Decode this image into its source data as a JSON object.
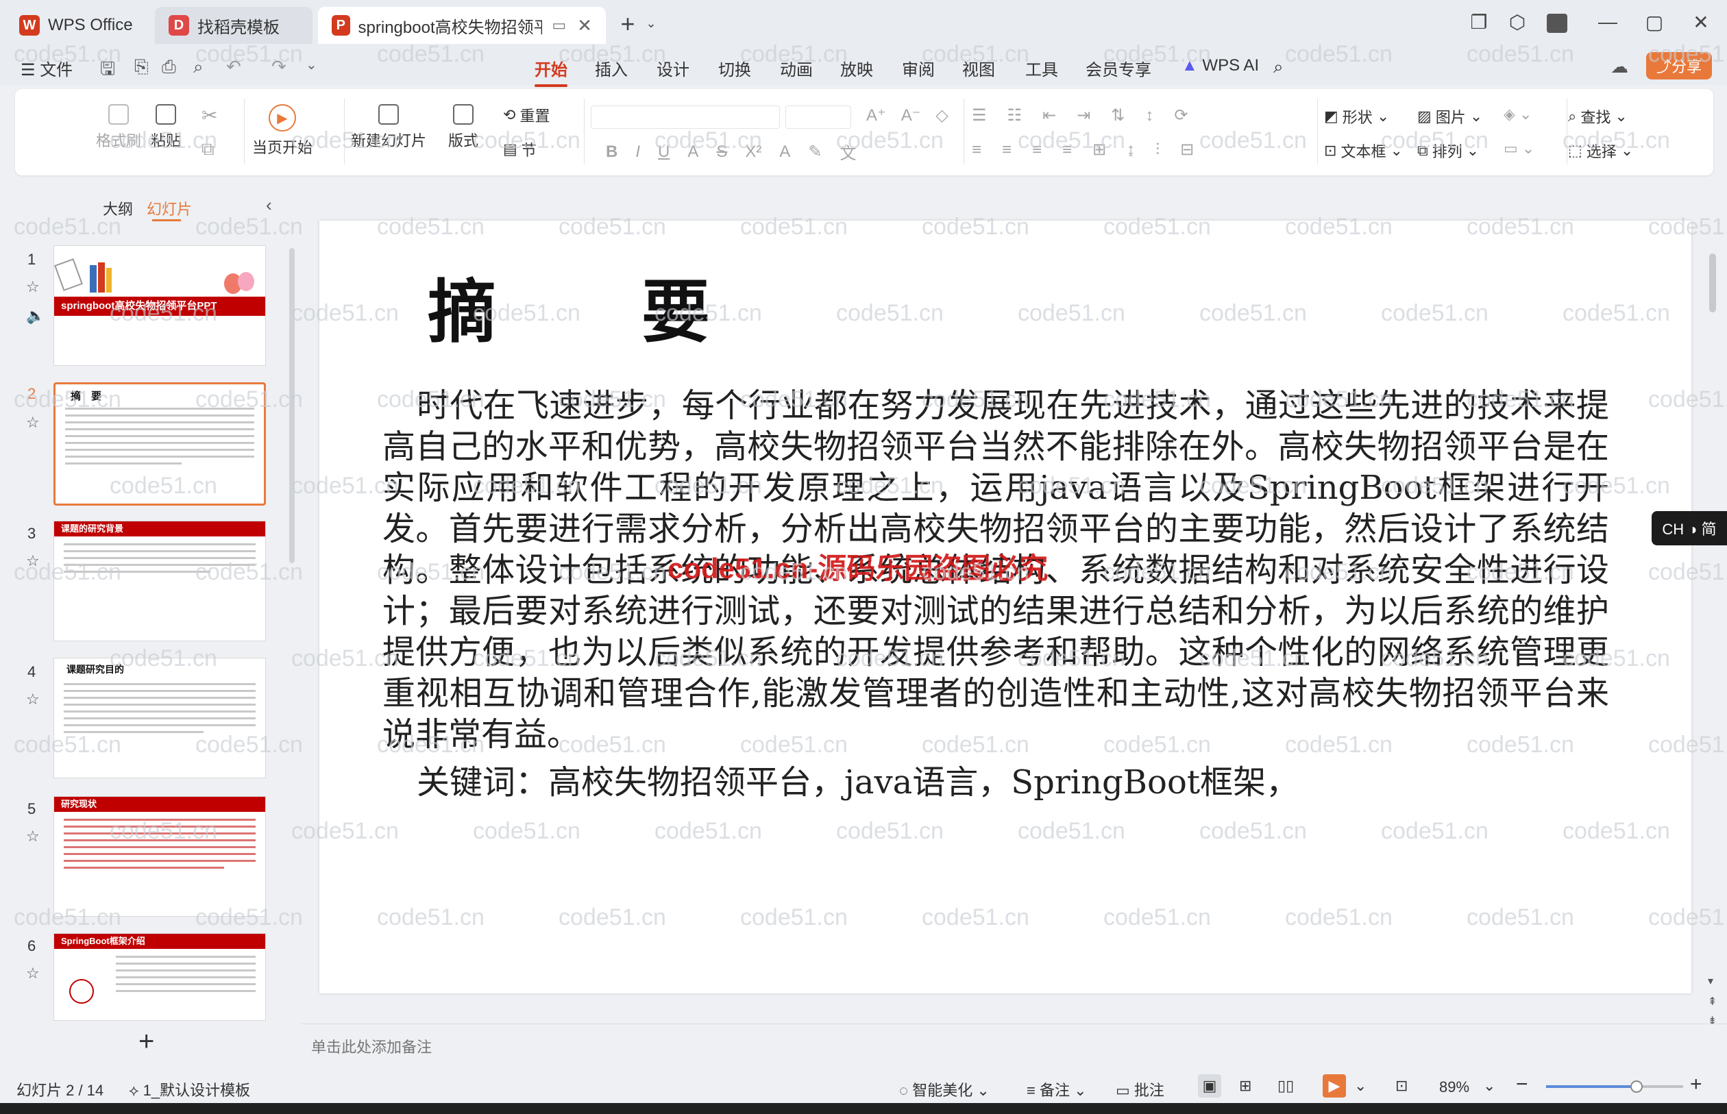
{
  "tabs": [
    {
      "label": "WPS Office",
      "logo_color": "#d33a1e"
    },
    {
      "label": "找稻壳模板",
      "logo_color": "#e04848"
    },
    {
      "label": "springboot高校失物招领平台",
      "logo_color": "#d33a1e"
    }
  ],
  "menu": {
    "file": "文件",
    "items": [
      "开始",
      "插入",
      "设计",
      "切换",
      "动画",
      "放映",
      "审阅",
      "视图",
      "工具",
      "会员专享"
    ],
    "active": "开始",
    "ai": "WPS AI",
    "share": "分享"
  },
  "ribbon": {
    "format_painter": "格式刷",
    "paste": "粘贴",
    "play_from_current": "当页开始",
    "new_slide": "新建幻灯片",
    "layout": "版式",
    "reset": "重置",
    "section": "节",
    "shape": "形状",
    "picture": "图片",
    "find": "查找",
    "textbox": "文本框",
    "arrange": "排列",
    "select": "选择"
  },
  "panel": {
    "outline_tab": "大纲",
    "slides_tab": "幻灯片",
    "add_label": "+"
  },
  "thumbnails": [
    {
      "num": "1",
      "title": "springboot高校失物招领平台PPT"
    },
    {
      "num": "2",
      "title": "摘　要"
    },
    {
      "num": "3",
      "title": "课题的研究背景"
    },
    {
      "num": "4",
      "title": "课题研究目的"
    },
    {
      "num": "5",
      "title": "研究现状"
    },
    {
      "num": "6",
      "title": "SpringBoot框架介绍"
    }
  ],
  "slide": {
    "title": "摘　要",
    "body": "时代在飞速进步，每个行业都在努力发展现在先进技术，通过这些先进的技术来提高自己的水平和优势，高校失物招领平台当然不能排除在外。高校失物招领平台是在实际应用和软件工程的开发原理之上，运用java语言以及SpringBoot框架进行开发。首先要进行需求分析，分析出高校失物招领平台的主要功能，然后设计了系统结构。整体设计包括系统的功能、系统总体结构、系统数据结构和对系统安全性进行设计；最后要对系统进行测试，还要对测试的结果进行总结和分析，为以后系统的维护提供方便，也为以后类似系统的开发提供参考和帮助。这种个性化的网络系统管理更重视相互协调和管理合作,能激发管理者的创造性和主动性,这对高校失物招领平台来说非常有益。",
    "keywords": "关键词：高校失物招领平台，java语言，SpringBoot框架，",
    "overlay": "code51.cn-源码乐园盗图必究"
  },
  "watermark": "code51.cn",
  "notes_placeholder": "单击此处添加备注",
  "status": {
    "slide_counter": "幻灯片 2 / 14",
    "template": "1_默认设计模板",
    "beautify": "智能美化",
    "notes": "备注",
    "comment": "批注",
    "zoom": "89%",
    "zoom_level": 0.89
  },
  "ime": "CH ◑ 简",
  "colors": {
    "accent": "#d33a1e",
    "share_bg": "#e8793b",
    "slide_red": "#c00000"
  }
}
